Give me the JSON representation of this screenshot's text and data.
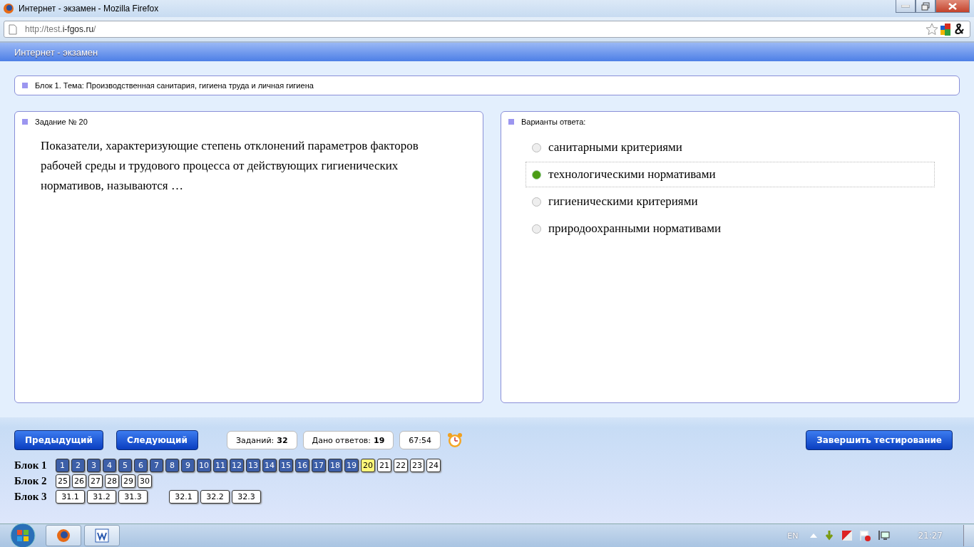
{
  "window": {
    "title": "Интернет - экзамен - Mozilla Firefox"
  },
  "address_bar": {
    "url_prefix": "http://test.",
    "url_domain": "i-fgos.ru",
    "url_suffix": "/"
  },
  "app_header": {
    "title": "Интернет - экзамен"
  },
  "block_bar": {
    "text": "Блок 1. Тема: Производственная санитария, гигиена труда и личная гигиена"
  },
  "question_panel": {
    "title": "Задание № 20",
    "text": "Показатели, характеризующие степень отклонений параметров факторов рабочей среды и трудового процесса от действующих гигиенических нормативов, называются …"
  },
  "answers_panel": {
    "title": "Варианты ответа:",
    "options": [
      {
        "label": "санитарными критериями",
        "selected": false
      },
      {
        "label": "технологическими нормативами",
        "selected": true
      },
      {
        "label": "гигиеническими критериями",
        "selected": false
      },
      {
        "label": "природоохранными нормативами",
        "selected": false
      }
    ]
  },
  "controls": {
    "prev_button": "Предыдущий",
    "next_button": "Следующий",
    "tasks_label": "Заданий:",
    "tasks_value": "32",
    "answered_label": "Дано ответов:",
    "answered_value": "19",
    "timer": "67:54",
    "finish_button": "Завершить тестирование"
  },
  "blocks": [
    {
      "label": "Блок 1",
      "groups": [
        [
          {
            "number": "1",
            "answered": true,
            "selected": false
          },
          {
            "number": "2",
            "answered": true,
            "selected": false
          },
          {
            "number": "3",
            "answered": true,
            "selected": false
          },
          {
            "number": "4",
            "answered": true,
            "selected": false
          },
          {
            "number": "5",
            "answered": true,
            "selected": false
          },
          {
            "number": "6",
            "answered": true,
            "selected": false
          },
          {
            "number": "7",
            "answered": true,
            "selected": false
          },
          {
            "number": "8",
            "answered": true,
            "selected": false
          },
          {
            "number": "9",
            "answered": true,
            "selected": false
          },
          {
            "number": "10",
            "answered": true,
            "selected": false
          },
          {
            "number": "11",
            "answered": true,
            "selected": false
          },
          {
            "number": "12",
            "answered": true,
            "selected": false
          },
          {
            "number": "13",
            "answered": true,
            "selected": false
          },
          {
            "number": "14",
            "answered": true,
            "selected": false
          },
          {
            "number": "15",
            "answered": true,
            "selected": false
          },
          {
            "number": "16",
            "answered": true,
            "selected": false
          },
          {
            "number": "17",
            "answered": true,
            "selected": false
          },
          {
            "number": "18",
            "answered": true,
            "selected": false
          },
          {
            "number": "19",
            "answered": true,
            "selected": false
          },
          {
            "number": "20",
            "answered": false,
            "selected": true
          },
          {
            "number": "21",
            "answered": false,
            "selected": false
          },
          {
            "number": "22",
            "answered": false,
            "selected": false
          },
          {
            "number": "23",
            "answered": false,
            "selected": false
          },
          {
            "number": "24",
            "answered": false,
            "selected": false
          }
        ]
      ]
    },
    {
      "label": "Блок 2",
      "groups": [
        [
          {
            "number": "25",
            "answered": false,
            "selected": false
          },
          {
            "number": "26",
            "answered": false,
            "selected": false
          },
          {
            "number": "27",
            "answered": false,
            "selected": false
          },
          {
            "number": "28",
            "answered": false,
            "selected": false
          },
          {
            "number": "29",
            "answered": false,
            "selected": false
          },
          {
            "number": "30",
            "answered": false,
            "selected": false
          }
        ]
      ]
    },
    {
      "label": "Блок 3",
      "groups": [
        [
          {
            "number": "31.1",
            "answered": false,
            "selected": false
          },
          {
            "number": "31.2",
            "answered": false,
            "selected": false
          },
          {
            "number": "31.3",
            "answered": false,
            "selected": false
          }
        ],
        [
          {
            "number": "32.1",
            "answered": false,
            "selected": false
          },
          {
            "number": "32.2",
            "answered": false,
            "selected": false
          },
          {
            "number": "32.3",
            "answered": false,
            "selected": false
          }
        ]
      ]
    }
  ],
  "taskbar": {
    "language": "EN",
    "clock": "21:27"
  }
}
